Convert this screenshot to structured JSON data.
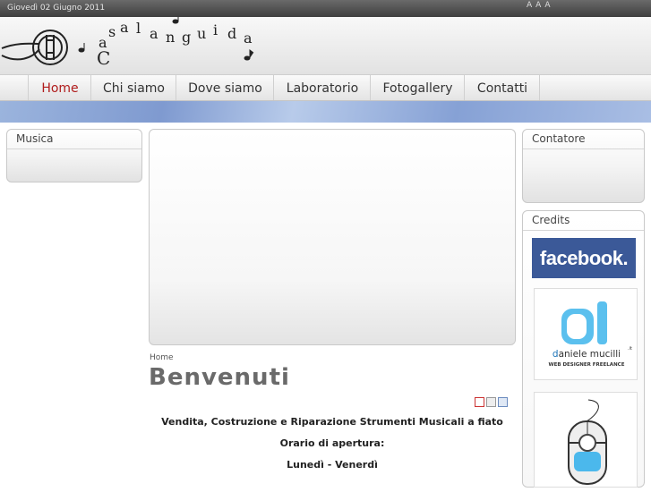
{
  "topbar": {
    "date": "Giovedì 02 Giugno 2011",
    "font_size_controls": [
      "A",
      "A",
      "A"
    ]
  },
  "logo": {
    "letters": [
      "C",
      "a",
      "s",
      "a",
      "l",
      "a",
      "n",
      "g",
      "u",
      "i",
      "d",
      "a"
    ]
  },
  "nav": {
    "items": [
      {
        "label": "Home",
        "active": true
      },
      {
        "label": "Chi siamo"
      },
      {
        "label": "Dove siamo"
      },
      {
        "label": "Laboratorio"
      },
      {
        "label": "Fotogallery"
      },
      {
        "label": "Contatti"
      }
    ]
  },
  "left": {
    "module_title": "Musica"
  },
  "right": {
    "counter_title": "Contatore",
    "credits_title": "Credits"
  },
  "main": {
    "breadcrumb": "Home",
    "title": "Benvenuti",
    "lines": [
      "Vendita, Costruzione e Riparazione Strumenti Musicali a fiato",
      "Orario di apertura:",
      "Lunedì - Venerdì"
    ]
  },
  "credits": {
    "facebook": "facebook.",
    "designer_name_first": "d",
    "designer_name_rest": "aniele mucilli",
    "designer_tld": ".it",
    "designer_sub": "WEB DESIGNER FREELANCE"
  },
  "colors": {
    "nav_active": "#b01c1c",
    "facebook_blue": "#3b5998",
    "topbar": "#4a4a4a"
  }
}
